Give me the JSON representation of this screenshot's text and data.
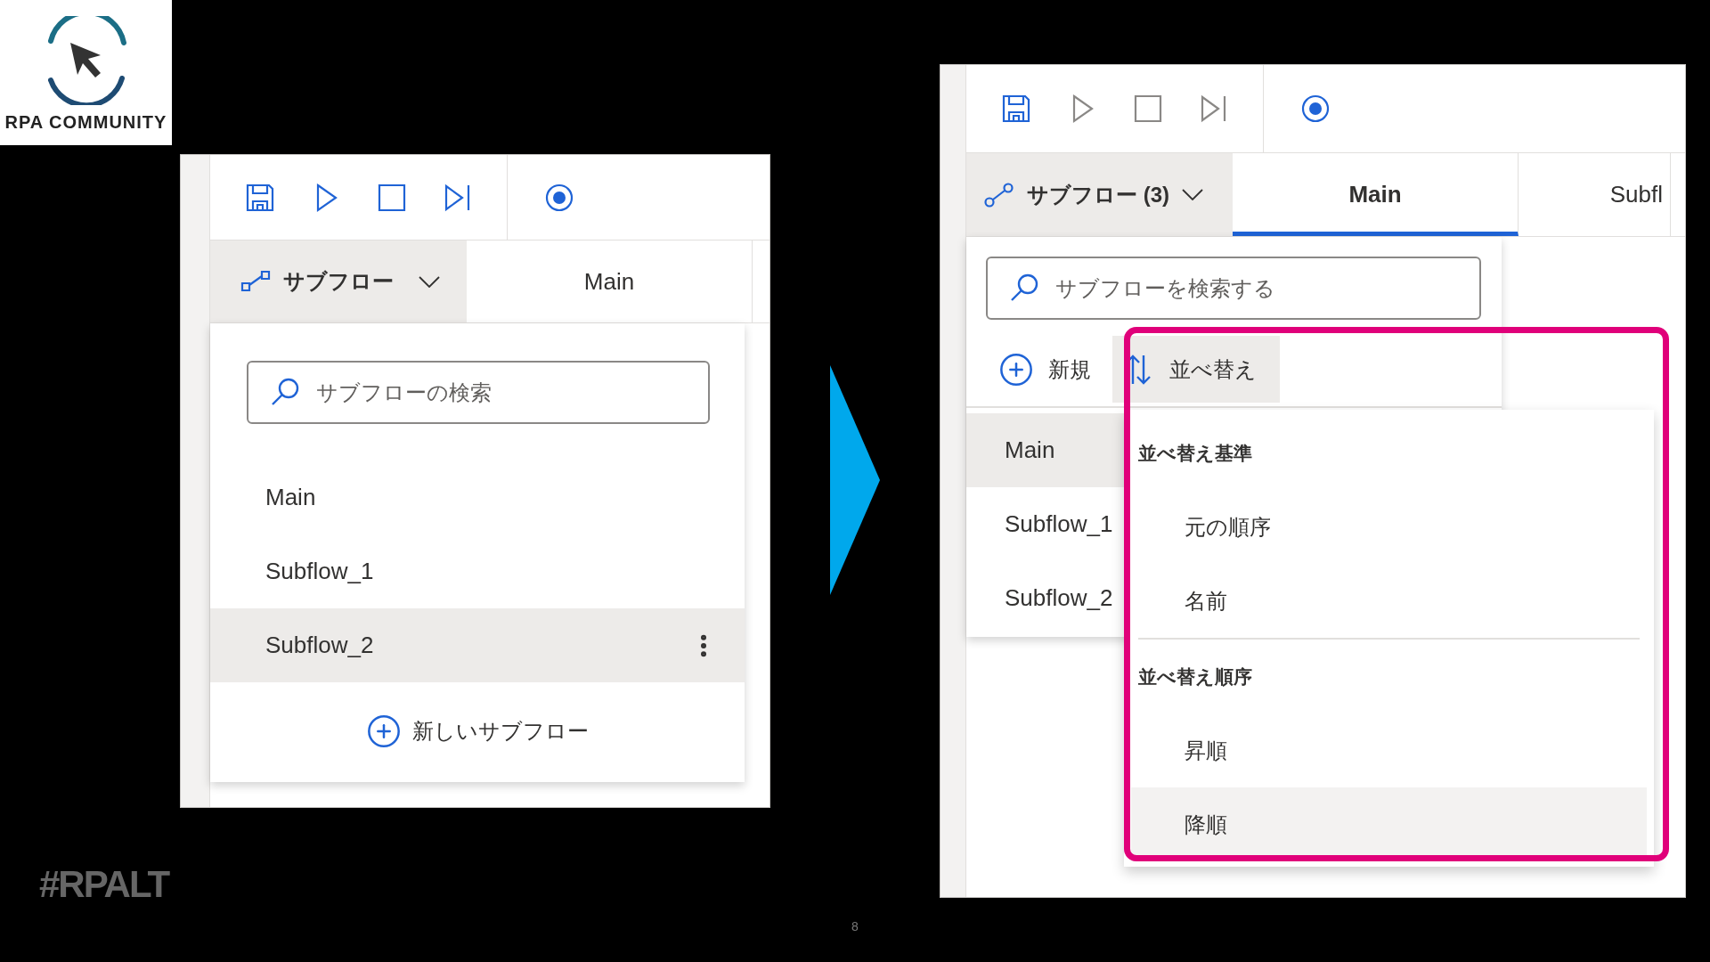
{
  "logo": {
    "text": "RPA COMMUNITY"
  },
  "before": {
    "toolbar": [
      {
        "kind": "save",
        "disabled": false
      },
      {
        "kind": "run",
        "disabled": false
      },
      {
        "kind": "stop",
        "disabled": false
      },
      {
        "kind": "next",
        "disabled": false
      },
      {
        "kind": "record",
        "disabled": false
      }
    ],
    "subflow_menu": {
      "label": "サブフロー"
    },
    "tabs": [
      {
        "label": "Main",
        "selected": false
      }
    ],
    "search": {
      "placeholder": "サブフローの検索"
    },
    "items": [
      {
        "label": "Main",
        "selected": false
      },
      {
        "label": "Subflow_1",
        "selected": false
      },
      {
        "label": "Subflow_2",
        "selected": true
      }
    ],
    "new_button": {
      "label": "新しいサブフロー"
    }
  },
  "after": {
    "toolbar": [
      {
        "kind": "save",
        "disabled": false
      },
      {
        "kind": "run",
        "disabled": true
      },
      {
        "kind": "stop",
        "disabled": true
      },
      {
        "kind": "next",
        "disabled": true
      },
      {
        "kind": "record",
        "disabled": false
      }
    ],
    "subflow_menu": {
      "label": "サブフロー (3)"
    },
    "tabs": [
      {
        "label": "Main",
        "selected": true
      },
      {
        "label": "Subfl",
        "selected": false
      }
    ],
    "search": {
      "placeholder": "サブフローを検索する"
    },
    "new_button": {
      "label": "新規"
    },
    "sort_button": {
      "label": "並べ替え"
    },
    "items": [
      {
        "label": "Main",
        "selected": true
      },
      {
        "label": "Subflow_1",
        "selected": false
      },
      {
        "label": "Subflow_2",
        "selected": false
      }
    ],
    "sort_menu": {
      "sections": [
        {
          "heading": "並べ替え基準",
          "options": [
            {
              "label": "元の順序",
              "selected": false
            },
            {
              "label": "名前",
              "selected": false
            }
          ]
        },
        {
          "heading": "並べ替え順序",
          "options": [
            {
              "label": "昇順",
              "selected": false
            },
            {
              "label": "降順",
              "selected": true
            }
          ]
        }
      ]
    }
  },
  "hashtag": "#RPALT",
  "page_number": "8"
}
